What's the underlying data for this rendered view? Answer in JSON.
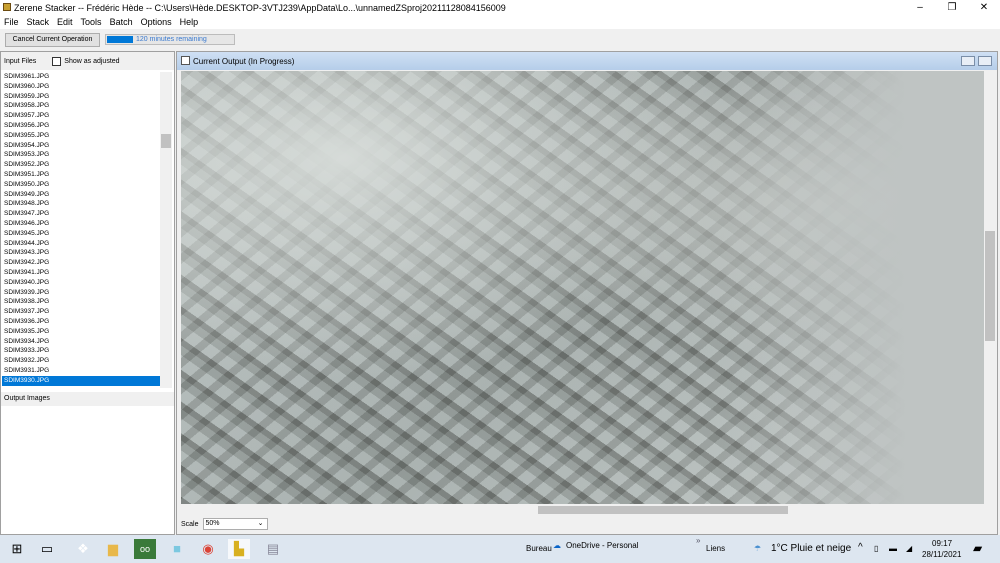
{
  "window": {
    "title": "Zerene Stacker -- Frédéric Hède -- C:\\Users\\Hède.DESKTOP-3VTJ239\\AppData\\Lo...\\unnamedZSproj20211128084156009"
  },
  "menu": [
    "File",
    "Stack",
    "Edit",
    "Tools",
    "Batch",
    "Options",
    "Help"
  ],
  "toolbar": {
    "cancel_label": "Cancel Current Operation",
    "progress_label": "120 minutes remaining",
    "progress_fraction": 0.2
  },
  "left": {
    "input_files_label": "Input Files",
    "show_adjusted_label": "Show as adjusted",
    "output_images_label": "Output Images",
    "files": [
      "SDIM3961.JPG",
      "SDIM3960.JPG",
      "SDIM3959.JPG",
      "SDIM3958.JPG",
      "SDIM3957.JPG",
      "SDIM3956.JPG",
      "SDIM3955.JPG",
      "SDIM3954.JPG",
      "SDIM3953.JPG",
      "SDIM3952.JPG",
      "SDIM3951.JPG",
      "SDIM3950.JPG",
      "SDIM3949.JPG",
      "SDIM3948.JPG",
      "SDIM3947.JPG",
      "SDIM3946.JPG",
      "SDIM3945.JPG",
      "SDIM3944.JPG",
      "SDIM3943.JPG",
      "SDIM3942.JPG",
      "SDIM3941.JPG",
      "SDIM3940.JPG",
      "SDIM3939.JPG",
      "SDIM3938.JPG",
      "SDIM3937.JPG",
      "SDIM3936.JPG",
      "SDIM3935.JPG",
      "SDIM3934.JPG",
      "SDIM3933.JPG",
      "SDIM3932.JPG",
      "SDIM3931.JPG",
      "SDIM3930.JPG"
    ],
    "selected": "SDIM3930.JPG"
  },
  "output": {
    "title": "Current Output (In Progress)",
    "scale_label": "Scale",
    "scale_value": "50%"
  },
  "taskbar": {
    "bureau": "Bureau",
    "onedrive": "OneDrive - Personal",
    "chevron": "»",
    "liens": "Liens",
    "weather": "1°C  Pluie et neige",
    "time": "09:17",
    "date": "28/11/2021"
  }
}
